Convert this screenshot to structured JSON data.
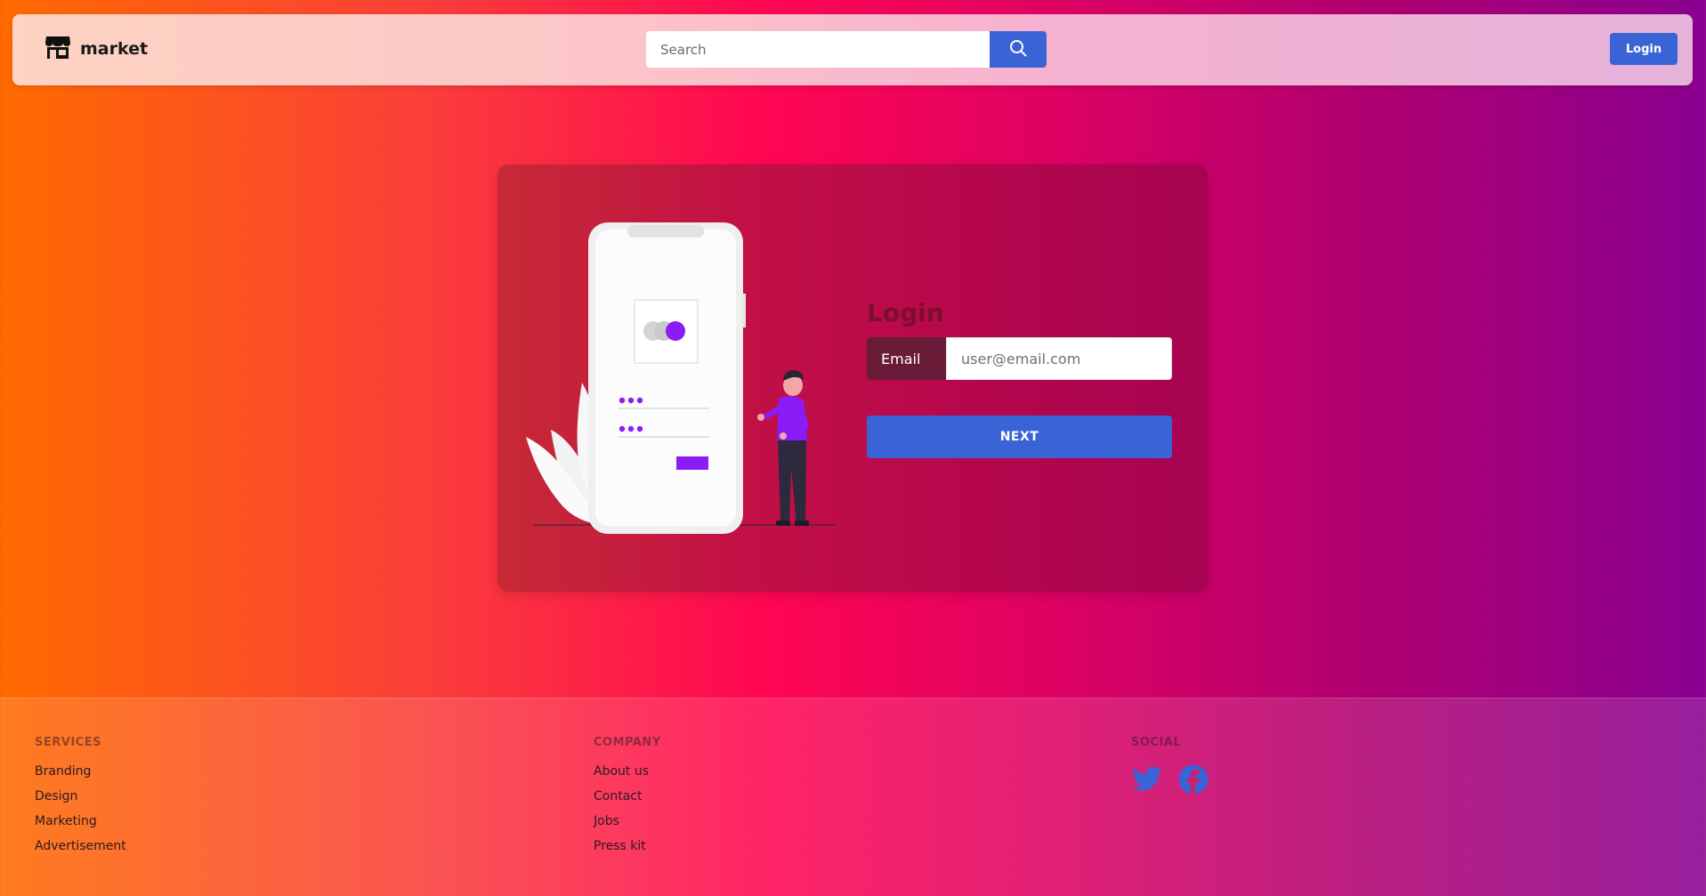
{
  "header": {
    "brand_name": "market",
    "brand_icon": "store-icon",
    "search_placeholder": "Search",
    "search_icon": "search-icon",
    "login_label": "Login"
  },
  "login_card": {
    "title": "Login",
    "email_label": "Email",
    "email_placeholder": "user@email.com",
    "next_label": "NEXT"
  },
  "footer": {
    "services": {
      "heading": "SERVICES",
      "links": [
        "Branding",
        "Design",
        "Marketing",
        "Advertisement"
      ]
    },
    "company": {
      "heading": "COMPANY",
      "links": [
        "About us",
        "Contact",
        "Jobs",
        "Press kit"
      ]
    },
    "social": {
      "heading": "SOCIAL",
      "icons": [
        "twitter-icon",
        "facebook-icon"
      ]
    }
  },
  "colors": {
    "primary": "#3a63d6",
    "accent_purple": "#8b1cf7"
  }
}
